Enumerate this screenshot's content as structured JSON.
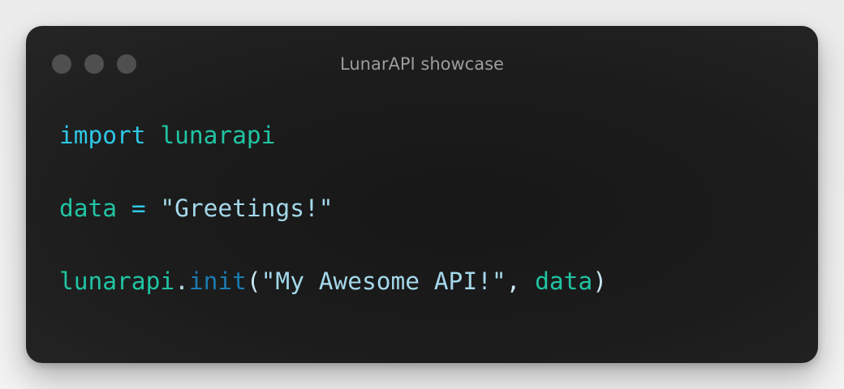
{
  "window": {
    "title": "LunarAPI showcase",
    "background": "#1c1c1c",
    "traffic_light_color": "#4f4f4f"
  },
  "code": {
    "language": "python",
    "line1": {
      "keyword": "import",
      "module": "lunarapi"
    },
    "line2": {
      "variable": "data",
      "operator": "=",
      "string": "\"Greetings!\""
    },
    "line3": {
      "object": "lunarapi",
      "dot": ".",
      "method": "init",
      "open_paren": "(",
      "string": "\"My Awesome API!\"",
      "comma": ",",
      "argument": "data",
      "close_paren": ")"
    }
  },
  "colors": {
    "keyword": "#2ec7e6",
    "identifier": "#20c4a3",
    "string": "#a4d8ea",
    "method": "#1b7bb0",
    "title_text": "#9c9c9c"
  }
}
